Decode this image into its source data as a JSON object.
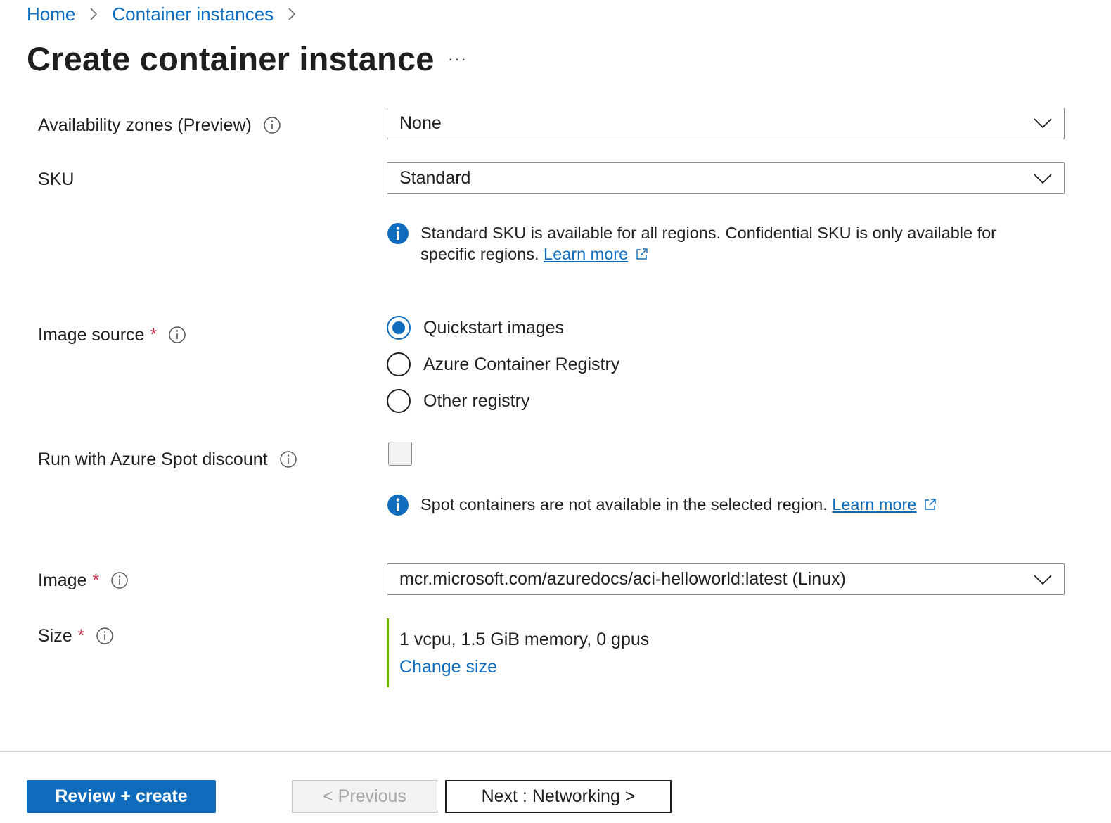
{
  "breadcrumb": {
    "items": [
      "Home",
      "Container instances"
    ]
  },
  "page": {
    "title": "Create container instance",
    "more_label": "···"
  },
  "availability_zones": {
    "label": "Availability zones (Preview)",
    "value": "None"
  },
  "sku": {
    "label": "SKU",
    "value": "Standard",
    "info_text": "Standard SKU is available for all regions. Confidential SKU is only available for specific regions.",
    "learn_more": "Learn more"
  },
  "image_source": {
    "label": "Image source",
    "required_mark": "*",
    "options": [
      "Quickstart images",
      "Azure Container Registry",
      "Other registry"
    ],
    "selected": "Quickstart images"
  },
  "spot": {
    "label": "Run with Azure Spot discount",
    "checked": false,
    "info_text": "Spot containers are not available in the selected region.",
    "learn_more": "Learn more"
  },
  "image": {
    "label": "Image",
    "required_mark": "*",
    "value": "mcr.microsoft.com/azuredocs/aci-helloworld:latest (Linux)"
  },
  "size": {
    "label": "Size",
    "required_mark": "*",
    "value": "1 vcpu, 1.5 GiB memory, 0 gpus",
    "change_link": "Change size"
  },
  "footer": {
    "review_create": "Review + create",
    "previous": "< Previous",
    "next": "Next : Networking >"
  },
  "colors": {
    "accent": "#0f6cbd",
    "required": "#c4314b",
    "size_bar": "#6bb700"
  },
  "icons": [
    "chevron-right-icon",
    "info-outline-icon",
    "chevron-down-icon",
    "info-filled-icon",
    "external-link-icon"
  ]
}
